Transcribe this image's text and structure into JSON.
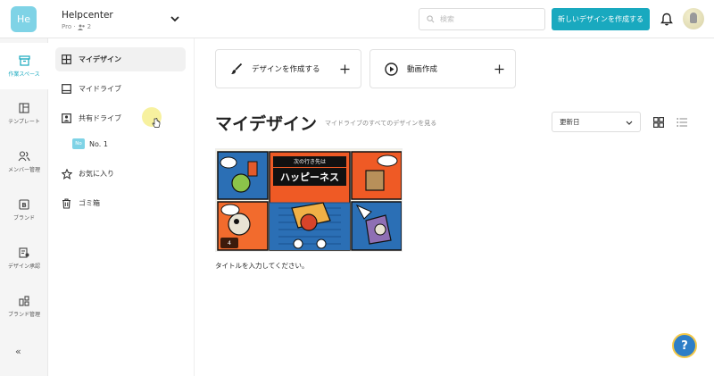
{
  "header": {
    "team_badge": "He",
    "team_name": "Helpcenter",
    "team_plan": "Pro ·",
    "team_members": "2",
    "search_placeholder": "検索",
    "create_button": "新しいデザインを作成する"
  },
  "rail": {
    "items": [
      {
        "label": "作業スペース",
        "icon": "workspace-icon"
      },
      {
        "label": "テンプレート",
        "icon": "template-icon"
      },
      {
        "label": "メンバー管理",
        "icon": "members-icon"
      },
      {
        "label": "ブランド",
        "icon": "brand-icon"
      },
      {
        "label": "デザイン承認",
        "icon": "approval-icon"
      },
      {
        "label": "ブランド管理",
        "icon": "brand-manage-icon"
      }
    ],
    "collapse": "«"
  },
  "sidebar": {
    "items": [
      {
        "label": "マイデザイン",
        "icon": "grid-icon"
      },
      {
        "label": "マイドライブ",
        "icon": "drive-icon"
      },
      {
        "label": "共有ドライブ",
        "icon": "shared-drive-icon"
      },
      {
        "label": "お気に入り",
        "icon": "star-icon"
      },
      {
        "label": "ゴミ箱",
        "icon": "trash-icon"
      }
    ],
    "shared_sub": {
      "badge": "No",
      "label": "No. 1"
    }
  },
  "main": {
    "actions": [
      {
        "label": "デザインを作成する",
        "icon": "brush-icon"
      },
      {
        "label": "動画作成",
        "icon": "play-icon"
      }
    ],
    "title": "マイデザイン",
    "subtitle": "マイドライブのすべてのデザインを見る",
    "sort_value": "更新日",
    "design": {
      "banner_small": "次の行き先は",
      "banner_big": "ハッピーネス",
      "page_count": "4",
      "title": "タイトルを入力してください。"
    }
  },
  "colors": {
    "accent": "#19a9bf",
    "badge": "#7fd3e6",
    "help": "#2e7ec7"
  },
  "help": "?"
}
